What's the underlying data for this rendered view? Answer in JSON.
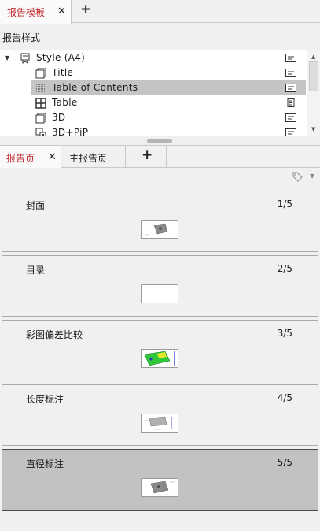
{
  "top_tabs": {
    "active_label": "报告模板",
    "close_glyph": "✕",
    "add_glyph": "+"
  },
  "template_section": {
    "label": "报告样式"
  },
  "tree": {
    "root": {
      "label": "Style (A4)",
      "icon": "report-style-icon"
    },
    "items": [
      {
        "label": "Title",
        "icon": "page-icon"
      },
      {
        "label": "Table of Contents",
        "icon": "toc-icon"
      },
      {
        "label": "Table",
        "icon": "table-icon"
      },
      {
        "label": "3D",
        "icon": "page-icon"
      },
      {
        "label": "3D+PiP",
        "icon": "pip-icon"
      }
    ],
    "selected_index": 1
  },
  "bottom_tabs": {
    "tab1": "报告页",
    "tab2": "主报告页",
    "close_glyph": "✕",
    "add_glyph": "+"
  },
  "pages": [
    {
      "title": "封面",
      "count": "1/5",
      "thumb": "gray-part"
    },
    {
      "title": "目录",
      "count": "2/5",
      "thumb": "blank"
    },
    {
      "title": "彩图偏差比较",
      "count": "3/5",
      "thumb": "green-part"
    },
    {
      "title": "长度标注",
      "count": "4/5",
      "thumb": "gray-part-dim"
    },
    {
      "title": "直径标注",
      "count": "5/5",
      "thumb": "gray-part"
    }
  ],
  "selected_page": 4,
  "colors": {
    "accent": "#c0282d",
    "selection": "#c4c4c4"
  }
}
